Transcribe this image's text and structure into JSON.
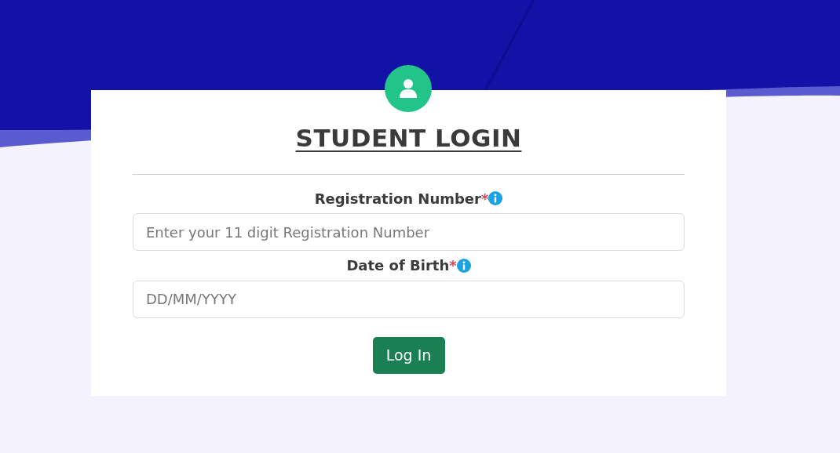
{
  "login_card": {
    "title": "STUDENT LOGIN",
    "fields": [
      {
        "label": "Registration Number",
        "required_mark": "*",
        "placeholder": "Enter your 11 digit Registration Number"
      },
      {
        "label": "Date of Birth",
        "required_mark": "*",
        "placeholder": "DD/MM/YYYY"
      }
    ],
    "submit_button": "Log In"
  }
}
